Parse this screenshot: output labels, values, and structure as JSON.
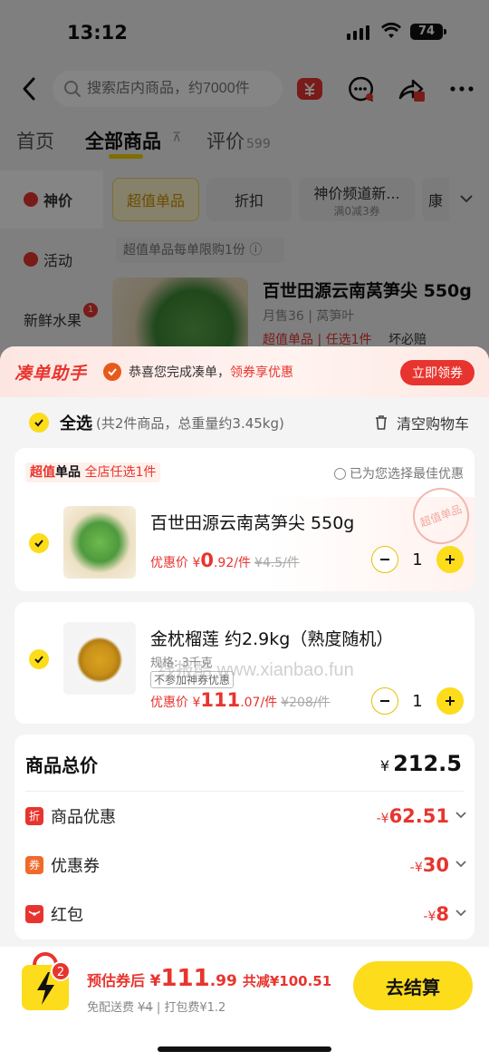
{
  "status": {
    "time": "13:12",
    "battery": "74"
  },
  "nav": {
    "search_placeholder": "搜索店内商品，约7000件"
  },
  "tabs": [
    {
      "label": "首页"
    },
    {
      "label": "全部商品"
    },
    {
      "label": "评价",
      "count": "599"
    }
  ],
  "sidebar": [
    {
      "label": "神价"
    },
    {
      "label": "活动"
    },
    {
      "label": "新鲜水果",
      "badge": "1"
    }
  ],
  "chips": [
    {
      "label": "超值单品"
    },
    {
      "label": "折扣"
    },
    {
      "label": "神价频道新...",
      "sub": "满0减3券"
    },
    {
      "label": "康"
    }
  ],
  "limit_tip": "超值单品每单限购1份",
  "bg_product": {
    "title": "百世田源云南莴笋尖 550g",
    "sub": "月售36 | 莴笋叶",
    "tags": "超值单品 | 任选1件",
    "guarantee": "坏必赔"
  },
  "sheet": {
    "helper_logo": "凑单助手",
    "helper_text": "恭喜您完成凑单，",
    "helper_highlight": "领券享优惠",
    "claim_button": "立即领券",
    "select_all": "全选",
    "select_all_sub": "(共2件商品，总重量约3.45kg)",
    "clear_cart": "清空购物车",
    "group_head_a": "超值",
    "group_head_b": "单品",
    "group_head_c": "全店任选1件",
    "best_deal": "已为您选择最佳优惠",
    "items": [
      {
        "title": "百世田源云南莴笋尖 550g",
        "price_label": "优惠价 ¥",
        "price_int": "0",
        "price_dec": ".92/件",
        "orig": "¥4.5/件",
        "qty": "1",
        "stamp": "超值单品"
      },
      {
        "title": "金枕榴莲 约2.9kg（熟度随机）",
        "spec": "规格: 3千克",
        "tag": "不参加神券优惠",
        "price_label": "优惠价 ¥",
        "price_int": "111",
        "price_dec": ".07/件",
        "orig": "¥208/件",
        "qty": "1"
      }
    ],
    "summary": {
      "total_label": "商品总价",
      "total_currency": "¥",
      "total_value": "212.5",
      "rows": [
        {
          "icon": "折",
          "label": "商品优惠",
          "prefix": "-¥",
          "value": "62.51"
        },
        {
          "icon": "券",
          "label": "优惠券",
          "prefix": "-¥",
          "value": "30"
        },
        {
          "icon": "",
          "label": "红包",
          "prefix": "-¥",
          "value": "8"
        }
      ]
    }
  },
  "checkout": {
    "bag_count": "2",
    "est_label": "预估券后",
    "est_currency": "¥",
    "est_int": "111",
    "est_dec": ".99",
    "saved": "共减¥100.51",
    "fees_a": "免配送费",
    "fees_strike": "¥4",
    "fees_b": "| 打包费¥1.2",
    "pay_button": "去结算"
  },
  "watermark": "线报酷 www.xianbao.fun",
  "colors": {
    "accent_yellow": "#fcdc1b",
    "accent_red": "#e8342e"
  }
}
